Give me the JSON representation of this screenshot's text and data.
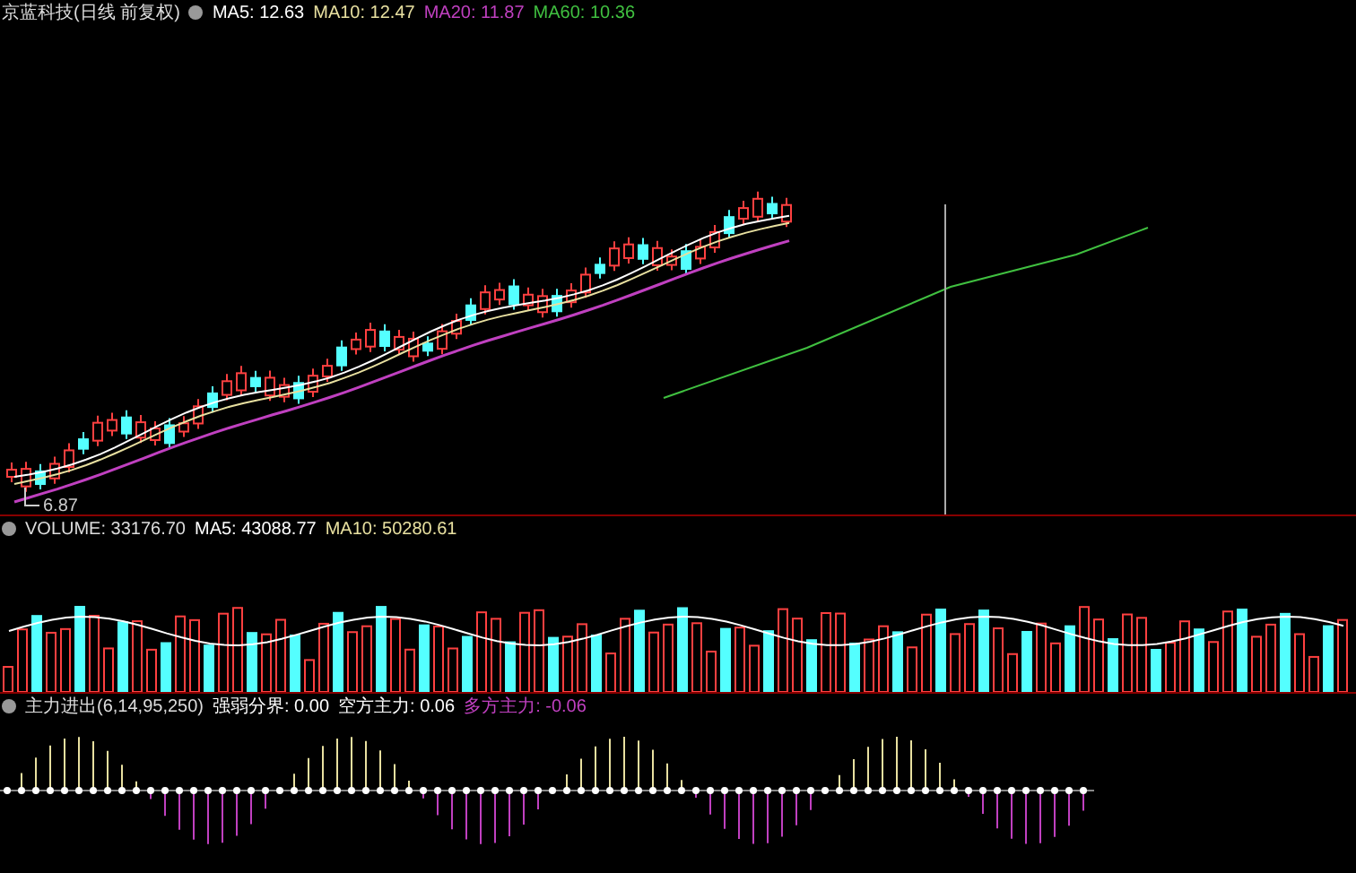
{
  "price_panel": {
    "title": "京蓝科技(日线 前复权)",
    "indicators": [
      {
        "label": "MA5: 12.63",
        "color": "#ffffff"
      },
      {
        "label": "MA10: 12.47",
        "color": "#e8e0a0"
      },
      {
        "label": "MA20: 11.87",
        "color": "#c040c0"
      },
      {
        "label": "MA60: 10.36",
        "color": "#40c040"
      }
    ],
    "low_label": "6.87"
  },
  "volume_panel": {
    "title": "VOLUME: 33176.70",
    "indicators": [
      {
        "label": "MA5: 43088.77",
        "color": "#ffffff"
      },
      {
        "label": "MA10: 50280.61",
        "color": "#e8e0a0"
      }
    ]
  },
  "flow_panel": {
    "title": "主力进出(6,14,95,250)",
    "indicators": [
      {
        "label": "强弱分界: 0.00",
        "color": "#ffffff"
      },
      {
        "label": "空方主力: 0.06",
        "color": "#ffffff"
      },
      {
        "label": "多方主力: -0.06",
        "color": "#c040c0"
      }
    ]
  }
}
